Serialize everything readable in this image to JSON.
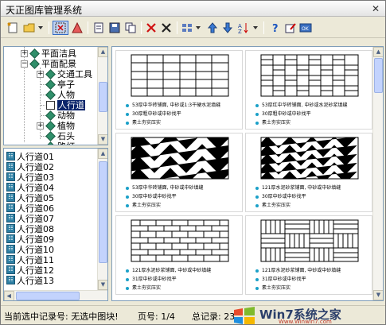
{
  "window": {
    "title": "天正图库管理系统",
    "close_glyph": "✕"
  },
  "tree": {
    "items": [
      {
        "label": "平面洁具"
      },
      {
        "label": "平面配景"
      },
      {
        "label": "交通工具"
      },
      {
        "label": "亭子"
      },
      {
        "label": "人物"
      },
      {
        "label": "人行道",
        "selected": true
      },
      {
        "label": "动物"
      },
      {
        "label": "植物"
      },
      {
        "label": "石头"
      },
      {
        "label": "路灯"
      }
    ]
  },
  "list": {
    "items": [
      "人行道01",
      "人行道02",
      "人行道03",
      "人行道04",
      "人行道05",
      "人行道06",
      "人行道07",
      "人行道08",
      "人行道09",
      "人行道10",
      "人行道11",
      "人行道12",
      "人行道13"
    ]
  },
  "preview": {
    "cells": [
      {
        "lines": [
          "53厚中华砖铺面, 中砂或1:3干硬水泥填缝",
          "30厚粗中砂或中砂找平",
          "素土夯实压实"
        ]
      },
      {
        "lines": [
          "53厚红中华砖铺面, 中砂或水泥砂浆填缝",
          "30厚粗中砂或中砂找平",
          "素土夯实压实"
        ]
      },
      {
        "lines": [
          "53厚中华砖铺面, 中砂或中砂填缝",
          "30厚中砂或中砂找平",
          "素土夯实压实"
        ]
      },
      {
        "lines": [
          "121厚水泥砂浆铺面, 中砂或中砂填缝",
          "30厚中砂或中砂找平",
          "素土夯实压实"
        ]
      },
      {
        "lines": [
          "121厚水泥砂浆铺面, 中砂或中砂填缝",
          "31厚中砂或中砂找平",
          "素土夯实压实"
        ]
      },
      {
        "lines": [
          "121厚水泥砂浆铺面, 中砂或中砂填缝",
          "31厚中砂或中砂找平",
          "素土夯实压实"
        ]
      }
    ]
  },
  "status": {
    "current_record": "当前选中记录号: 无选中图块!",
    "page": "页号: 1/4",
    "total": "总记录: 23"
  },
  "watermark": {
    "text": "Win7系统之家",
    "url": "Www.Winwin7.com"
  },
  "colors": {
    "selection": "#0a246a",
    "accent": "#1aa0c8"
  }
}
